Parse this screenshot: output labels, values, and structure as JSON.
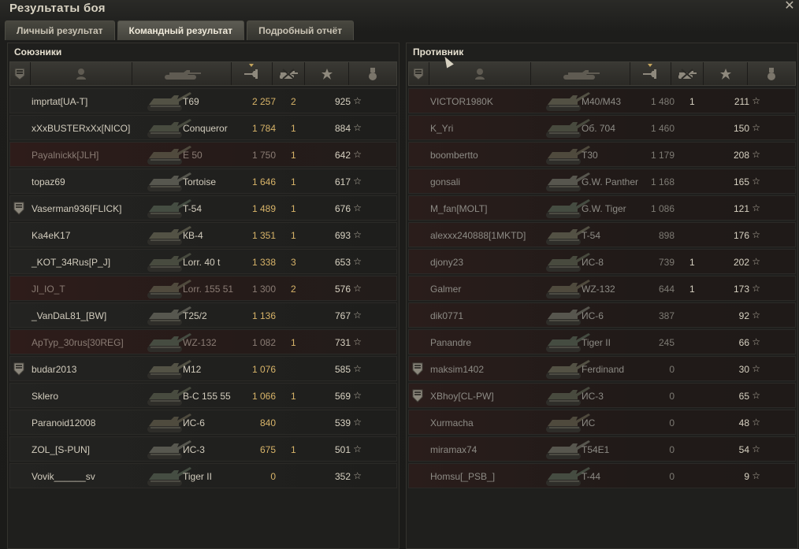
{
  "window": {
    "title": "Результаты боя",
    "close_icon": "close-icon"
  },
  "tabs": [
    {
      "label": "Личный результат",
      "active": false
    },
    {
      "label": "Командный результат",
      "active": true
    },
    {
      "label": "Подробный отчёт",
      "active": false
    }
  ],
  "colors": {
    "gold": "#d8b469",
    "dead_row": "#2e1c1a",
    "active_tab": "#5d5c53"
  },
  "allies": {
    "title": "Союзники",
    "header_icons": [
      "platoon-icon",
      "player-icon",
      "tank-icon",
      "damage-icon",
      "kills-icon",
      "xp-star-icon",
      "medal-icon"
    ],
    "rows": [
      {
        "player": "imprtat[UA-T]",
        "vehicle": "T69",
        "damage": "2 257",
        "kills": "2",
        "xp": "925",
        "dead": false,
        "platoon": false
      },
      {
        "player": "xXxBUSTERxXx[NICO]",
        "vehicle": "Conqueror",
        "damage": "1 784",
        "kills": "1",
        "xp": "884",
        "dead": false,
        "platoon": false
      },
      {
        "player": "Payalnickk[JLH]",
        "vehicle": "E 50",
        "damage": "1 750",
        "kills": "1",
        "xp": "642",
        "dead": true,
        "platoon": false
      },
      {
        "player": "topaz69",
        "vehicle": "Tortoise",
        "damage": "1 646",
        "kills": "1",
        "xp": "617",
        "dead": false,
        "platoon": false
      },
      {
        "player": "Vaserman936[FLICK]",
        "vehicle": "T-54",
        "damage": "1 489",
        "kills": "1",
        "xp": "676",
        "dead": false,
        "platoon": true
      },
      {
        "player": "Ka4eK17",
        "vehicle": "КВ-4",
        "damage": "1 351",
        "kills": "1",
        "xp": "693",
        "dead": false,
        "platoon": false
      },
      {
        "player": "_KOT_34Rus[P_J]",
        "vehicle": "Lorr. 40 t",
        "damage": "1 338",
        "kills": "3",
        "xp": "653",
        "dead": false,
        "platoon": false
      },
      {
        "player": "JI_IO_T",
        "vehicle": "Lorr. 155 51",
        "damage": "1 300",
        "kills": "2",
        "xp": "576",
        "dead": true,
        "platoon": false
      },
      {
        "player": "_VanDaL81_[BW]",
        "vehicle": "T25/2",
        "damage": "1 136",
        "kills": "",
        "xp": "767",
        "dead": false,
        "platoon": false
      },
      {
        "player": "ApTyp_30rus[30REG]",
        "vehicle": "WZ-132",
        "damage": "1 082",
        "kills": "1",
        "xp": "731",
        "dead": true,
        "platoon": false
      },
      {
        "player": "budar2013",
        "vehicle": "M12",
        "damage": "1 076",
        "kills": "",
        "xp": "585",
        "dead": false,
        "platoon": true
      },
      {
        "player": "Sklero",
        "vehicle": "B-C 155 55",
        "damage": "1 066",
        "kills": "1",
        "xp": "569",
        "dead": false,
        "platoon": false
      },
      {
        "player": "Paranoid12008",
        "vehicle": "ИС-6",
        "damage": "840",
        "kills": "",
        "xp": "539",
        "dead": false,
        "platoon": false
      },
      {
        "player": "ZOL_[S-PUN]",
        "vehicle": "ИС-3",
        "damage": "675",
        "kills": "1",
        "xp": "501",
        "dead": false,
        "platoon": false
      },
      {
        "player": "Vovik______sv",
        "vehicle": "Tiger II",
        "damage": "0",
        "kills": "",
        "xp": "352",
        "dead": false,
        "platoon": false
      }
    ]
  },
  "enemies": {
    "title": "Противник",
    "header_icons": [
      "platoon-icon",
      "player-icon",
      "tank-icon",
      "damage-icon",
      "kills-icon",
      "xp-star-icon",
      "medal-icon"
    ],
    "rows": [
      {
        "player": "VICTOR1980K",
        "vehicle": "M40/M43",
        "damage": "1 480",
        "kills": "1",
        "xp": "211",
        "platoon": false
      },
      {
        "player": "K_Yri",
        "vehicle": "Об. 704",
        "damage": "1 460",
        "kills": "",
        "xp": "150",
        "platoon": false
      },
      {
        "player": "boombertto",
        "vehicle": "T30",
        "damage": "1 179",
        "kills": "",
        "xp": "208",
        "platoon": false
      },
      {
        "player": "gonsali",
        "vehicle": "G.W. Panther",
        "damage": "1 168",
        "kills": "",
        "xp": "165",
        "platoon": false
      },
      {
        "player": "M_fan[MOLT]",
        "vehicle": "G.W. Tiger",
        "damage": "1 086",
        "kills": "",
        "xp": "121",
        "platoon": false
      },
      {
        "player": "alexxx240888[1MKTD]",
        "vehicle": "T-54",
        "damage": "898",
        "kills": "",
        "xp": "176",
        "platoon": false
      },
      {
        "player": "djony23",
        "vehicle": "ИС-8",
        "damage": "739",
        "kills": "1",
        "xp": "202",
        "platoon": false
      },
      {
        "player": "Galmer",
        "vehicle": "WZ-132",
        "damage": "644",
        "kills": "1",
        "xp": "173",
        "platoon": false
      },
      {
        "player": "dik0771",
        "vehicle": "ИС-6",
        "damage": "387",
        "kills": "",
        "xp": "92",
        "platoon": false
      },
      {
        "player": "Panandre",
        "vehicle": "Tiger II",
        "damage": "245",
        "kills": "",
        "xp": "66",
        "platoon": false
      },
      {
        "player": "maksim1402",
        "vehicle": "Ferdinand",
        "damage": "0",
        "kills": "",
        "xp": "30",
        "platoon": true
      },
      {
        "player": "XBhoy[CL-PW]",
        "vehicle": "ИС-3",
        "damage": "0",
        "kills": "",
        "xp": "65",
        "platoon": true
      },
      {
        "player": "Xurmacha",
        "vehicle": "ИС",
        "damage": "0",
        "kills": "",
        "xp": "48",
        "platoon": false
      },
      {
        "player": "miramax74",
        "vehicle": "T54E1",
        "damage": "0",
        "kills": "",
        "xp": "54",
        "platoon": false
      },
      {
        "player": "Homsu[_PSB_]",
        "vehicle": "T-44",
        "damage": "0",
        "kills": "",
        "xp": "9",
        "platoon": false
      }
    ]
  }
}
